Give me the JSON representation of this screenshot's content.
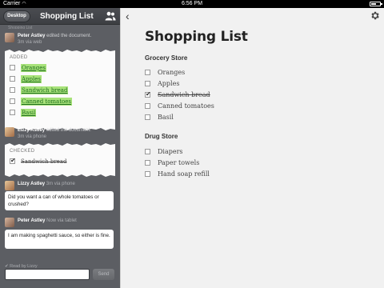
{
  "status_bar": {
    "carrier": "Carrier",
    "time": "6:56 PM"
  },
  "sidebar": {
    "desktop_button": "Desktop",
    "title": "Shopping List",
    "cut_text": "Shopping List",
    "activity1": {
      "name": "Peter Astley",
      "action": "edited the document.",
      "via": "3m via web"
    },
    "added_card": {
      "label": "ADDED",
      "items": [
        "Oranges",
        "Apples",
        "Sandwich bread",
        "Canned tomatoes",
        "Basil"
      ]
    },
    "activity2": {
      "name": "Lizzy Astley",
      "action": "edited the document.",
      "via": "3m via phone"
    },
    "checked_card": {
      "label": "CHECKED",
      "items": [
        "Sandwich bread"
      ]
    },
    "message1": {
      "name": "Lizzy Astley",
      "via": "3m via phone",
      "text": "Did you want a can of whole tomatoes or crushed?"
    },
    "message2": {
      "name": "Peter Astley",
      "via": "Now via tablet",
      "text": "I am making spaghetti sauce, so either is fine."
    },
    "read_by": "✔ Read by Lizzy",
    "send_button": "Send",
    "compose_placeholder": ""
  },
  "document": {
    "title": "Shopping List",
    "sections": [
      {
        "heading": "Grocery Store",
        "items": [
          {
            "text": "Oranges",
            "checked": false
          },
          {
            "text": "Apples",
            "checked": false
          },
          {
            "text": "Sandwich bread",
            "checked": true
          },
          {
            "text": "Canned tomatoes",
            "checked": false
          },
          {
            "text": "Basil",
            "checked": false
          }
        ]
      },
      {
        "heading": "Drug Store",
        "items": [
          {
            "text": "Diapers",
            "checked": false
          },
          {
            "text": "Paper towels",
            "checked": false
          },
          {
            "text": "Hand soap refill",
            "checked": false
          }
        ]
      }
    ]
  },
  "icons": {
    "back": "chevron-left-icon",
    "settings": "gear-icon",
    "people": "people-icon",
    "checkmark": "checkmark-icon"
  }
}
